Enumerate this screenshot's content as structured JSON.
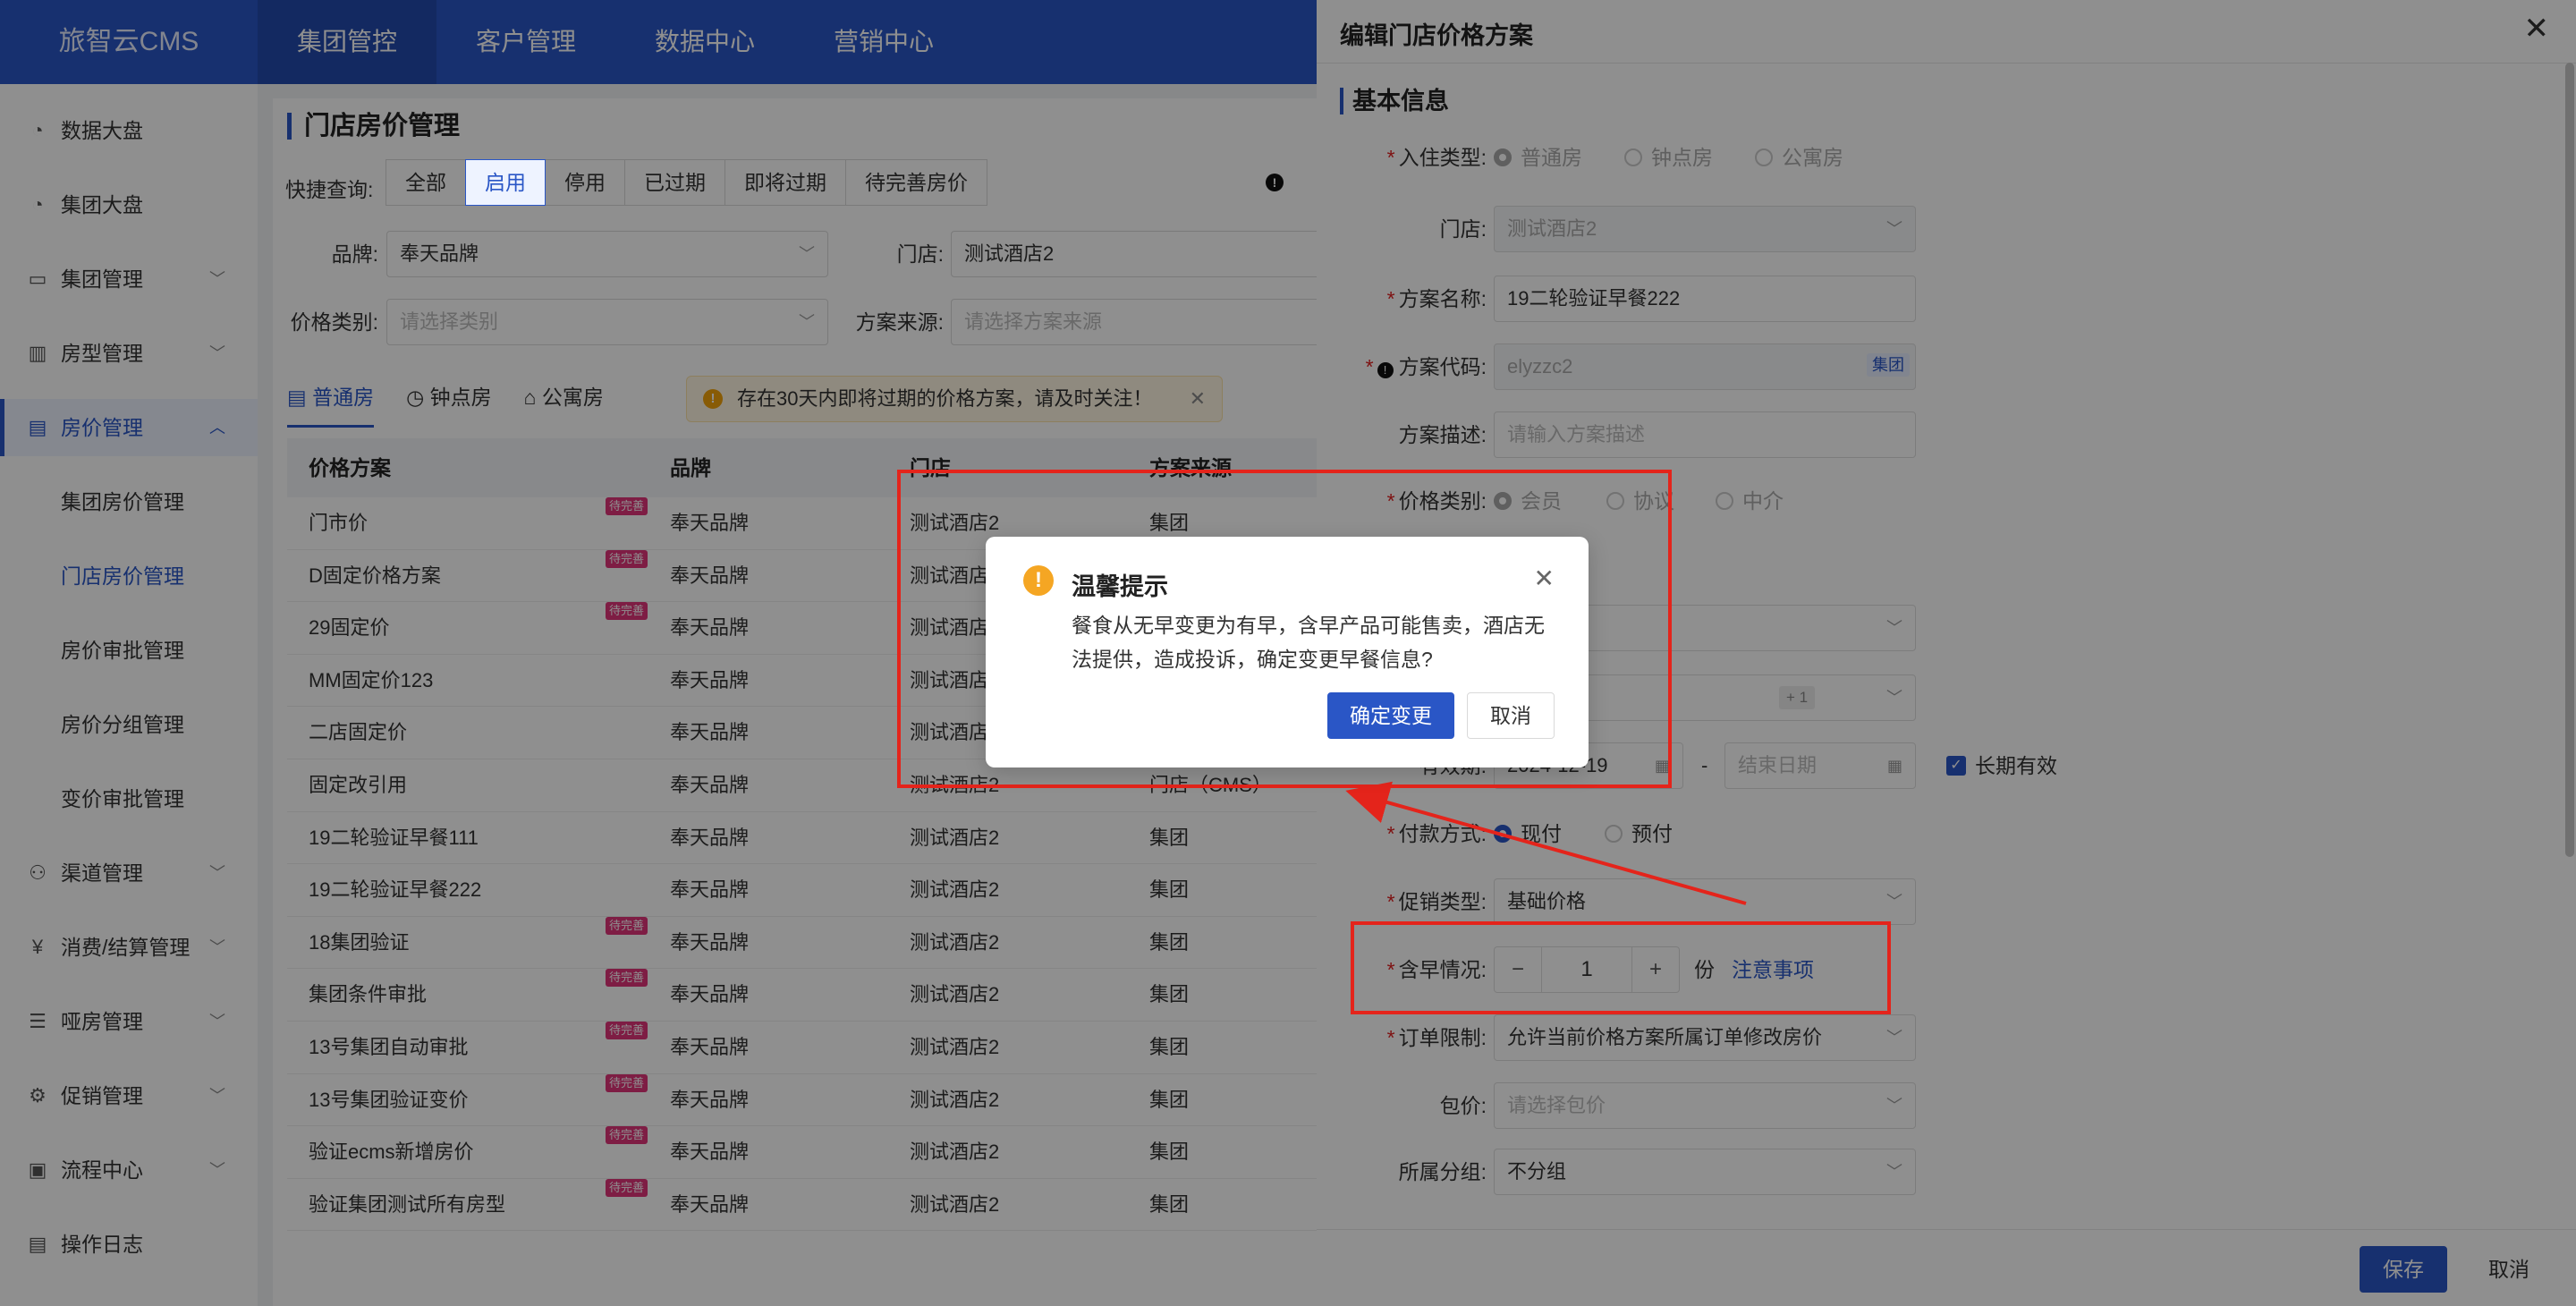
{
  "app": {
    "logo": "旅智云CMS"
  },
  "topnav": [
    "集团管控",
    "客户管理",
    "数据中心",
    "营销中心"
  ],
  "sidebar": {
    "items": [
      {
        "label": "数据大盘",
        "icon": "dashboard-icon"
      },
      {
        "label": "集团大盘",
        "icon": "dashboard-icon"
      },
      {
        "label": "集团管理",
        "icon": "monitor-icon"
      },
      {
        "label": "房型管理",
        "icon": "building-icon"
      },
      {
        "label": "房价管理",
        "icon": "window-icon"
      },
      {
        "label": "集团房价管理"
      },
      {
        "label": "门店房价管理"
      },
      {
        "label": "房价审批管理"
      },
      {
        "label": "房价分组管理"
      },
      {
        "label": "变价审批管理"
      },
      {
        "label": "渠道管理",
        "icon": "network-icon"
      },
      {
        "label": "消费/结算管理",
        "icon": "yen-icon"
      },
      {
        "label": "哑房管理",
        "icon": "document-icon"
      },
      {
        "label": "促销管理",
        "icon": "gear-icon"
      },
      {
        "label": "流程中心",
        "icon": "clipboard-icon"
      },
      {
        "label": "操作日志",
        "icon": "log-icon"
      }
    ]
  },
  "main": {
    "title": "门店房价管理",
    "quick_label": "快捷查询:",
    "quick_buttons": [
      "全部",
      "启用",
      "停用",
      "已过期",
      "即将过期",
      "待完善房价"
    ],
    "brand_label": "品牌:",
    "brand_value": "奉天品牌",
    "store_label": "门店:",
    "store_value": "测试酒店2",
    "price_type_label": "价格类别:",
    "price_type_placeholder": "请选择类别",
    "source_label": "方案来源:",
    "source_placeholder": "请选择方案来源",
    "tabs": [
      "普通房",
      "钟点房",
      "公寓房"
    ],
    "notice": "存在30天内即将过期的价格方案，请及时关注！",
    "table": {
      "headers": [
        "价格方案",
        "品牌",
        "门店",
        "方案来源"
      ],
      "tag": "待完善",
      "rows": [
        {
          "plan": "门市价",
          "brand": "奉天品牌",
          "store": "测试酒店2",
          "source": "集团",
          "tag": true
        },
        {
          "plan": "D固定价格方案",
          "brand": "奉天品牌",
          "store": "测试酒店2",
          "source": "",
          "tag": true
        },
        {
          "plan": "29固定价",
          "brand": "奉天品牌",
          "store": "测试酒店2",
          "source": "",
          "tag": true
        },
        {
          "plan": "MM固定价123",
          "brand": "奉天品牌",
          "store": "测试酒店2",
          "source": "",
          "tag": false
        },
        {
          "plan": "二店固定价",
          "brand": "奉天品牌",
          "store": "测试酒店2",
          "source": "",
          "tag": false
        },
        {
          "plan": "固定改引用",
          "brand": "奉天品牌",
          "store": "测试酒店2",
          "source": "门店（CMS）",
          "tag": false
        },
        {
          "plan": "19二轮验证早餐111",
          "brand": "奉天品牌",
          "store": "测试酒店2",
          "source": "集团",
          "tag": false
        },
        {
          "plan": "19二轮验证早餐222",
          "brand": "奉天品牌",
          "store": "测试酒店2",
          "source": "集团",
          "tag": false
        },
        {
          "plan": "18集团验证",
          "brand": "奉天品牌",
          "store": "测试酒店2",
          "source": "集团",
          "tag": true
        },
        {
          "plan": "集团条件审批",
          "brand": "奉天品牌",
          "store": "测试酒店2",
          "source": "集团",
          "tag": true
        },
        {
          "plan": "13号集团自动审批",
          "brand": "奉天品牌",
          "store": "测试酒店2",
          "source": "集团",
          "tag": true
        },
        {
          "plan": "13号集团验证变价",
          "brand": "奉天品牌",
          "store": "测试酒店2",
          "source": "集团",
          "tag": true
        },
        {
          "plan": "验证ecms新增房价",
          "brand": "奉天品牌",
          "store": "测试酒店2",
          "source": "集团",
          "tag": true
        },
        {
          "plan": "验证集团测试所有房型",
          "brand": "奉天品牌",
          "store": "测试酒店2",
          "source": "集团",
          "tag": true
        }
      ]
    }
  },
  "drawer": {
    "title": "编辑门店价格方案",
    "section": "基本信息",
    "checkin_label": "入住类型:",
    "checkin_options": [
      "普通房",
      "钟点房",
      "公寓房"
    ],
    "store_label": "门店:",
    "store_value": "测试酒店2",
    "name_label": "方案名称:",
    "name_value": "19二轮验证早餐222",
    "code_label": "方案代码:",
    "code_value": "elyzzc2",
    "code_tag": "集团",
    "desc_label": "方案描述:",
    "desc_placeholder": "请输入方案描述",
    "price_type_label": "价格类别:",
    "price_type_options": [
      "会员",
      "协议",
      "中介"
    ],
    "plus_one": "+ 1",
    "validity_label": "有效期:",
    "validity_start": "2024-12-19",
    "dash": "-",
    "validity_end_placeholder": "结束日期",
    "long_term": "长期有效",
    "pay_label": "付款方式:",
    "pay_options": [
      "现付",
      "预付"
    ],
    "promo_label": "促销类型:",
    "promo_value": "基础价格",
    "breakfast_label": "含早情况:",
    "breakfast_value": "1",
    "breakfast_unit": "份",
    "breakfast_link": "注意事项",
    "order_label": "订单限制:",
    "order_value": "允许当前价格方案所属订单修改房价",
    "package_label": "包价:",
    "package_placeholder": "请选择包价",
    "group_label": "所属分组:",
    "group_value": "不分组",
    "save": "保存",
    "cancel": "取消"
  },
  "modal": {
    "title": "温馨提示",
    "message": "餐食从无早变更为有早，含早产品可能售卖，酒店无法提供，造成投诉，确定变更早餐信息?",
    "confirm": "确定变更",
    "cancel": "取消"
  },
  "colors": {
    "primary": "#2a56c6",
    "annotation": "#e4241b",
    "warning": "#f5a623",
    "tag": "#e0357a"
  }
}
